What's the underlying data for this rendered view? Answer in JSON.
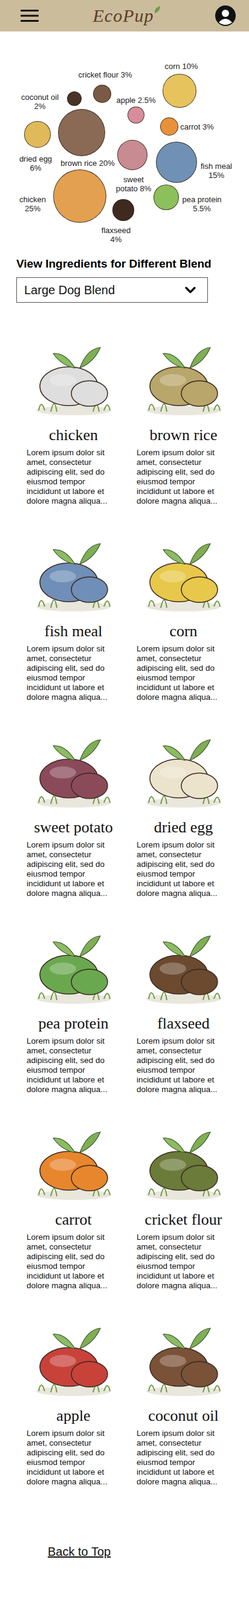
{
  "header": {
    "logo": "EcoPup"
  },
  "chart": {
    "bubbles": [
      {
        "name": "cricket flour",
        "value": 3,
        "reading": "3%",
        "color": "#7a5a45"
      },
      {
        "name": "corn",
        "value": 10,
        "reading": "10%",
        "color": "#e6c35c"
      },
      {
        "name": "coconut oil",
        "value": 2,
        "reading": "2%",
        "color": "#4a3428"
      },
      {
        "name": "apple",
        "value": 2.5,
        "reading": "2.5%",
        "color": "#d88d9c"
      },
      {
        "name": "brown rice",
        "value": 20,
        "reading": "20%",
        "color": "#8b6a55"
      },
      {
        "name": "carrot",
        "value": 3,
        "reading": "3%",
        "color": "#e8913a"
      },
      {
        "name": "dried egg",
        "value": 6,
        "reading": "6%",
        "color": "#e0b95a"
      },
      {
        "name": "sweet potato",
        "value": 8,
        "reading": "8%",
        "color": "#c98b92"
      },
      {
        "name": "fish meal",
        "value": 15,
        "reading": "15%",
        "color": "#7091b5"
      },
      {
        "name": "pea protein",
        "value": 5.5,
        "reading": "5.5%",
        "color": "#8cc05a"
      },
      {
        "name": "chicken",
        "value": 25,
        "reading": "25%",
        "color": "#e3a050"
      },
      {
        "name": "flaxseed",
        "value": 4,
        "reading": "4%",
        "color": "#3f2a20"
      }
    ]
  },
  "blend": {
    "heading": "View Ingredients for Different Blend",
    "value": "Large Dog Blend"
  },
  "ingredients": [
    {
      "name": "chicken",
      "color": "#dedede",
      "description": "Lorem ipsum dolor sit amet, consectetur adipiscing elit, sed do eiusmod tempor incididunt ut labore et dolore magna aliqua..."
    },
    {
      "name": "brown rice",
      "color": "#b9a66a",
      "description": "Lorem ipsum dolor sit amet, consectetur adipiscing elit, sed do eiusmod tempor incididunt ut labore et dolore magna aliqua..."
    },
    {
      "name": "fish meal",
      "color": "#6f8fb8",
      "description": "Lorem ipsum dolor sit amet, consectetur adipiscing elit, sed do eiusmod tempor incididunt ut labore et dolore magna aliqua..."
    },
    {
      "name": "corn",
      "color": "#e8c84a",
      "description": "Lorem ipsum dolor sit amet, consectetur adipiscing elit, sed do eiusmod tempor incididunt ut labore et dolore magna aliqua..."
    },
    {
      "name": "sweet potato",
      "color": "#8a4a5a",
      "description": "Lorem ipsum dolor sit amet, consectetur adipiscing elit, sed do eiusmod tempor incididunt ut labore et dolore magna aliqua..."
    },
    {
      "name": "dried egg",
      "color": "#ece3cc",
      "description": "Lorem ipsum dolor sit amet, consectetur adipiscing elit, sed do eiusmod tempor incididunt ut labore et dolore magna aliqua..."
    },
    {
      "name": "pea protein",
      "color": "#6aa84f",
      "description": "Lorem ipsum dolor sit amet, consectetur adipiscing elit, sed do eiusmod tempor incididunt ut labore et dolore magna aliqua..."
    },
    {
      "name": "flaxseed",
      "color": "#6b4a30",
      "description": "Lorem ipsum dolor sit amet, consectetur adipiscing elit, sed do eiusmod tempor incididunt ut labore et dolore magna aliqua..."
    },
    {
      "name": "carrot",
      "color": "#e8862e",
      "description": "Lorem ipsum dolor sit amet, consectetur adipiscing elit, sed do eiusmod tempor incididunt ut labore et dolore magna aliqua..."
    },
    {
      "name": "cricket flour",
      "color": "#6b7b3a",
      "description": "Lorem ipsum dolor sit amet, consectetur adipiscing elit, sed do eiusmod tempor incididunt ut labore et dolore magna aliqua..."
    },
    {
      "name": "apple",
      "color": "#c8423a",
      "description": "Lorem ipsum dolor sit amet, consectetur adipiscing elit, sed do eiusmod tempor incididunt ut labore et dolore magna aliqua..."
    },
    {
      "name": "coconut oil",
      "color": "#7a5238",
      "description": "Lorem ipsum dolor sit amet, consectetur adipiscing elit, sed do eiusmod tempor incididunt ut labore et dolore magna aliqua..."
    }
  ],
  "footer": {
    "link": "Back to Top"
  }
}
